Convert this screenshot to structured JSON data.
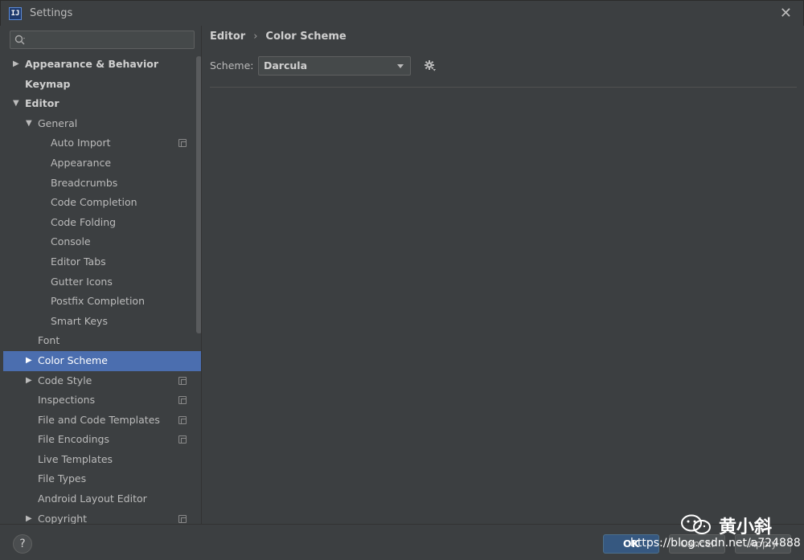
{
  "window": {
    "title": "Settings",
    "app_icon_text": "IJ"
  },
  "search": {
    "placeholder": ""
  },
  "tree": [
    {
      "label": "Appearance & Behavior",
      "level": 0,
      "arrow": "▶",
      "bold": true,
      "proj": false
    },
    {
      "label": "Keymap",
      "level": 0,
      "arrow": "",
      "bold": true,
      "proj": false
    },
    {
      "label": "Editor",
      "level": 0,
      "arrow": "▼",
      "bold": true,
      "proj": false
    },
    {
      "label": "General",
      "level": 1,
      "arrow": "▼",
      "bold": false,
      "proj": false
    },
    {
      "label": "Auto Import",
      "level": 2,
      "arrow": "",
      "bold": false,
      "proj": true
    },
    {
      "label": "Appearance",
      "level": 2,
      "arrow": "",
      "bold": false,
      "proj": false
    },
    {
      "label": "Breadcrumbs",
      "level": 2,
      "arrow": "",
      "bold": false,
      "proj": false
    },
    {
      "label": "Code Completion",
      "level": 2,
      "arrow": "",
      "bold": false,
      "proj": false
    },
    {
      "label": "Code Folding",
      "level": 2,
      "arrow": "",
      "bold": false,
      "proj": false
    },
    {
      "label": "Console",
      "level": 2,
      "arrow": "",
      "bold": false,
      "proj": false
    },
    {
      "label": "Editor Tabs",
      "level": 2,
      "arrow": "",
      "bold": false,
      "proj": false
    },
    {
      "label": "Gutter Icons",
      "level": 2,
      "arrow": "",
      "bold": false,
      "proj": false
    },
    {
      "label": "Postfix Completion",
      "level": 2,
      "arrow": "",
      "bold": false,
      "proj": false
    },
    {
      "label": "Smart Keys",
      "level": 2,
      "arrow": "",
      "bold": false,
      "proj": false
    },
    {
      "label": "Font",
      "level": 1,
      "arrow": "",
      "bold": false,
      "proj": false
    },
    {
      "label": "Color Scheme",
      "level": 1,
      "arrow": "▶",
      "bold": false,
      "proj": false,
      "selected": true
    },
    {
      "label": "Code Style",
      "level": 1,
      "arrow": "▶",
      "bold": false,
      "proj": true
    },
    {
      "label": "Inspections",
      "level": 1,
      "arrow": "",
      "bold": false,
      "proj": true
    },
    {
      "label": "File and Code Templates",
      "level": 1,
      "arrow": "",
      "bold": false,
      "proj": true
    },
    {
      "label": "File Encodings",
      "level": 1,
      "arrow": "",
      "bold": false,
      "proj": true
    },
    {
      "label": "Live Templates",
      "level": 1,
      "arrow": "",
      "bold": false,
      "proj": false
    },
    {
      "label": "File Types",
      "level": 1,
      "arrow": "",
      "bold": false,
      "proj": false
    },
    {
      "label": "Android Layout Editor",
      "level": 1,
      "arrow": "",
      "bold": false,
      "proj": false
    },
    {
      "label": "Copyright",
      "level": 1,
      "arrow": "▶",
      "bold": false,
      "proj": true
    }
  ],
  "breadcrumb": {
    "parent": "Editor",
    "separator": "›",
    "current": "Color Scheme"
  },
  "scheme": {
    "label": "Scheme:",
    "value": "Darcula"
  },
  "footer": {
    "help_label": "?",
    "ok_label": "OK",
    "cancel_label": "Cancel",
    "apply_label": "Apply"
  },
  "watermark": {
    "name": "黄小斜",
    "url": "https://blog.csdn.net/a724888"
  },
  "colors": {
    "selection": "#4b6eaf",
    "background": "#3c3f41",
    "primary_button": "#365880"
  }
}
